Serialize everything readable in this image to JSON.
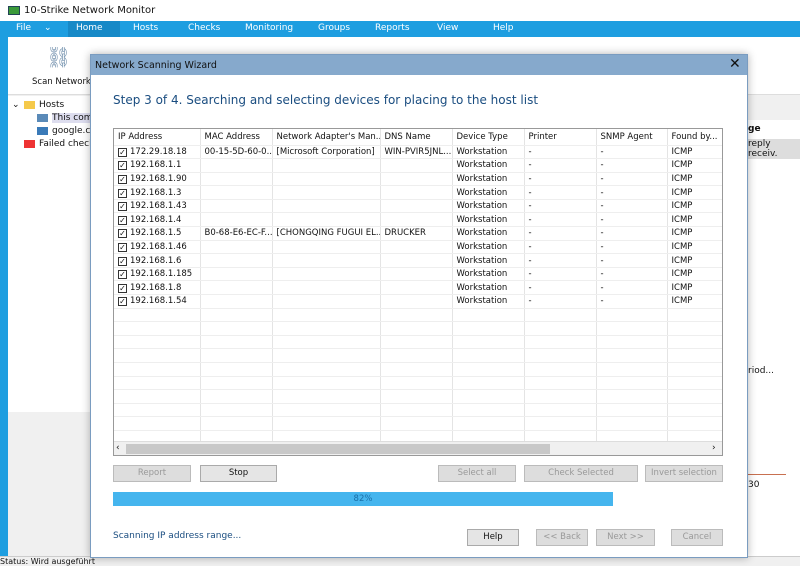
{
  "app": {
    "title": "10-Strike Network Monitor",
    "status": "Status: Wird ausgeführt"
  },
  "menu": [
    "File",
    "Home",
    "Hosts",
    "Checks",
    "Monitoring",
    "Groups",
    "Reports",
    "View",
    "Help"
  ],
  "ribbon": {
    "scan_label": "Scan Network..."
  },
  "tree": {
    "hosts": "Hosts",
    "this_comp": "This comp",
    "google": "google.co",
    "failed": "Failed checks"
  },
  "right_fragments": {
    "header": "ge",
    "row": "reply receiv.",
    "period": "riod...",
    "value": "30"
  },
  "dialog": {
    "title": "Network Scanning Wizard",
    "step": "Step 3 of 4. Searching and selecting devices for placing to the host list",
    "columns": [
      "IP Address",
      "MAC Address",
      "Network Adapter's Man...",
      "DNS Name",
      "Device Type",
      "Printer",
      "SNMP Agent",
      "Found by..."
    ],
    "rows": [
      {
        "checked": true,
        "cells": [
          "172.29.18.18",
          "00-15-5D-60-0...",
          "[Microsoft Corporation]",
          "WIN-PVIR5JNL...",
          "Workstation",
          "-",
          "-",
          "ICMP"
        ]
      },
      {
        "checked": true,
        "cells": [
          "192.168.1.1",
          "",
          "",
          "",
          "Workstation",
          "-",
          "-",
          "ICMP"
        ]
      },
      {
        "checked": true,
        "cells": [
          "192.168.1.90",
          "",
          "",
          "",
          "Workstation",
          "-",
          "-",
          "ICMP"
        ]
      },
      {
        "checked": true,
        "cells": [
          "192.168.1.3",
          "",
          "",
          "",
          "Workstation",
          "-",
          "-",
          "ICMP"
        ]
      },
      {
        "checked": true,
        "cells": [
          "192.168.1.43",
          "",
          "",
          "",
          "Workstation",
          "-",
          "-",
          "ICMP"
        ]
      },
      {
        "checked": true,
        "cells": [
          "192.168.1.4",
          "",
          "",
          "",
          "Workstation",
          "-",
          "-",
          "ICMP"
        ]
      },
      {
        "checked": true,
        "cells": [
          "192.168.1.5",
          "B0-68-E6-EC-F...",
          "[CHONGQING FUGUI EL...",
          "DRUCKER",
          "Workstation",
          "-",
          "-",
          "ICMP"
        ]
      },
      {
        "checked": true,
        "cells": [
          "192.168.1.46",
          "",
          "",
          "",
          "Workstation",
          "-",
          "-",
          "ICMP"
        ]
      },
      {
        "checked": true,
        "cells": [
          "192.168.1.6",
          "",
          "",
          "",
          "Workstation",
          "-",
          "-",
          "ICMP"
        ]
      },
      {
        "checked": true,
        "cells": [
          "192.168.1.185",
          "",
          "",
          "",
          "Workstation",
          "-",
          "-",
          "ICMP"
        ]
      },
      {
        "checked": true,
        "cells": [
          "192.168.1.8",
          "",
          "",
          "",
          "Workstation",
          "-",
          "-",
          "ICMP"
        ]
      },
      {
        "checked": true,
        "cells": [
          "192.168.1.54",
          "",
          "",
          "",
          "Workstation",
          "-",
          "-",
          "ICMP"
        ]
      }
    ],
    "buttons": {
      "report": "Report",
      "stop": "Stop",
      "select_all": "Select all",
      "check_selected": "Check Selected",
      "invert": "Invert selection",
      "help": "Help",
      "back": "<< Back",
      "next": "Next >>",
      "cancel": "Cancel"
    },
    "progress": {
      "percent": 82,
      "label": "82%"
    },
    "scan_status": "Scanning IP address range..."
  },
  "colors": {
    "accent": "#1e9ee0",
    "progress": "#45b5ee",
    "dialog_header": "#86a9cc"
  }
}
